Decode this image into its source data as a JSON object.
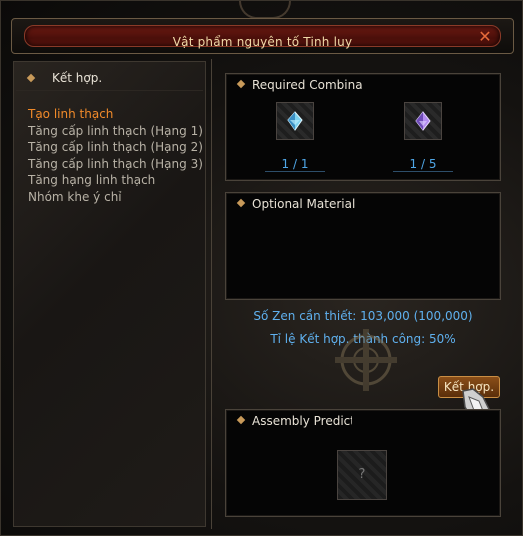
{
  "window": {
    "title": "Vật phẩm nguyên tố Tinh luy"
  },
  "left_panel": {
    "title": "Kết hợp.",
    "menu": [
      {
        "label": "Tạo linh thạch",
        "active": true
      },
      {
        "label": "Tăng cấp linh thạch (Hạng 1)",
        "active": false
      },
      {
        "label": "Tăng cấp linh thạch (Hạng 2)",
        "active": false
      },
      {
        "label": "Tăng cấp linh thạch (Hạng 3)",
        "active": false
      },
      {
        "label": "Tăng hạng linh thạch",
        "active": false
      },
      {
        "label": "Nhóm khe ý chỉ",
        "active": false
      }
    ]
  },
  "required": {
    "title": "Required Combina",
    "slots": [
      {
        "icon": "blue-crystal-icon",
        "count": "1 / 1"
      },
      {
        "icon": "purple-crystal-icon",
        "count": "1 / 5"
      }
    ]
  },
  "optional": {
    "title": "Optional Material"
  },
  "info": {
    "zen": "Số Zen cần thiết: 103,000 (100,000)",
    "rate": "Tỉ lệ Kết hợp. thành công: 50%"
  },
  "combine_button": "Kết hợp.",
  "prediction": {
    "title": "Assembly Predictic",
    "slot_mark": "?"
  },
  "colors": {
    "accent": "#f08a2a",
    "info": "#5fb0ee",
    "title_bar": "#6e1a12"
  }
}
